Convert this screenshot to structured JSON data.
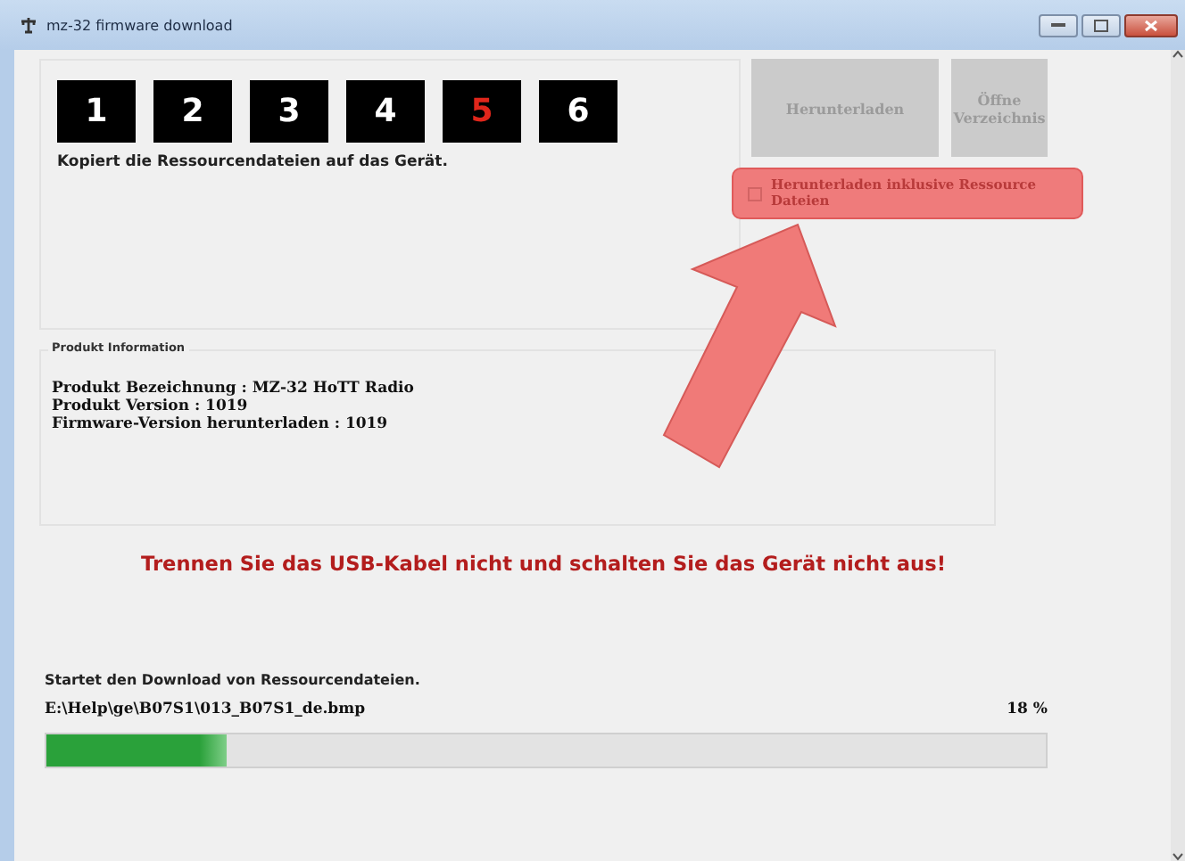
{
  "window": {
    "title": "mz-32 firmware download"
  },
  "steps": [
    {
      "label": "1",
      "selected": false
    },
    {
      "label": "2",
      "selected": false
    },
    {
      "label": "3",
      "selected": false
    },
    {
      "label": "4",
      "selected": false
    },
    {
      "label": "5",
      "selected": true
    },
    {
      "label": "6",
      "selected": false
    }
  ],
  "step_description": "Kopiert die Ressourcendateien auf das Gerät.",
  "buttons": [
    {
      "label": "Herunterladen",
      "disabled": true
    },
    {
      "label": "Öffne Verzeichnis",
      "disabled": true
    }
  ],
  "checkbox": {
    "label": "Herunterladen inklusive Ressource Dateien",
    "checked": false
  },
  "product_info": {
    "title": "Produkt Information",
    "lines": [
      "Produkt Bezeichnung : MZ-32 HoTT Radio",
      "Produkt Version : 1019",
      "Firmware-Version herunterladen : 1019"
    ]
  },
  "warning": "Trennen Sie das USB-Kabel nicht und schalten Sie das Gerät nicht aus!",
  "status": "Startet den Download von Ressourcendateien.",
  "file": "E:\\Help\\ge\\B07S1\\013_B07S1_de.bmp",
  "progress": {
    "level": 0.18,
    "reading": "18 %"
  }
}
